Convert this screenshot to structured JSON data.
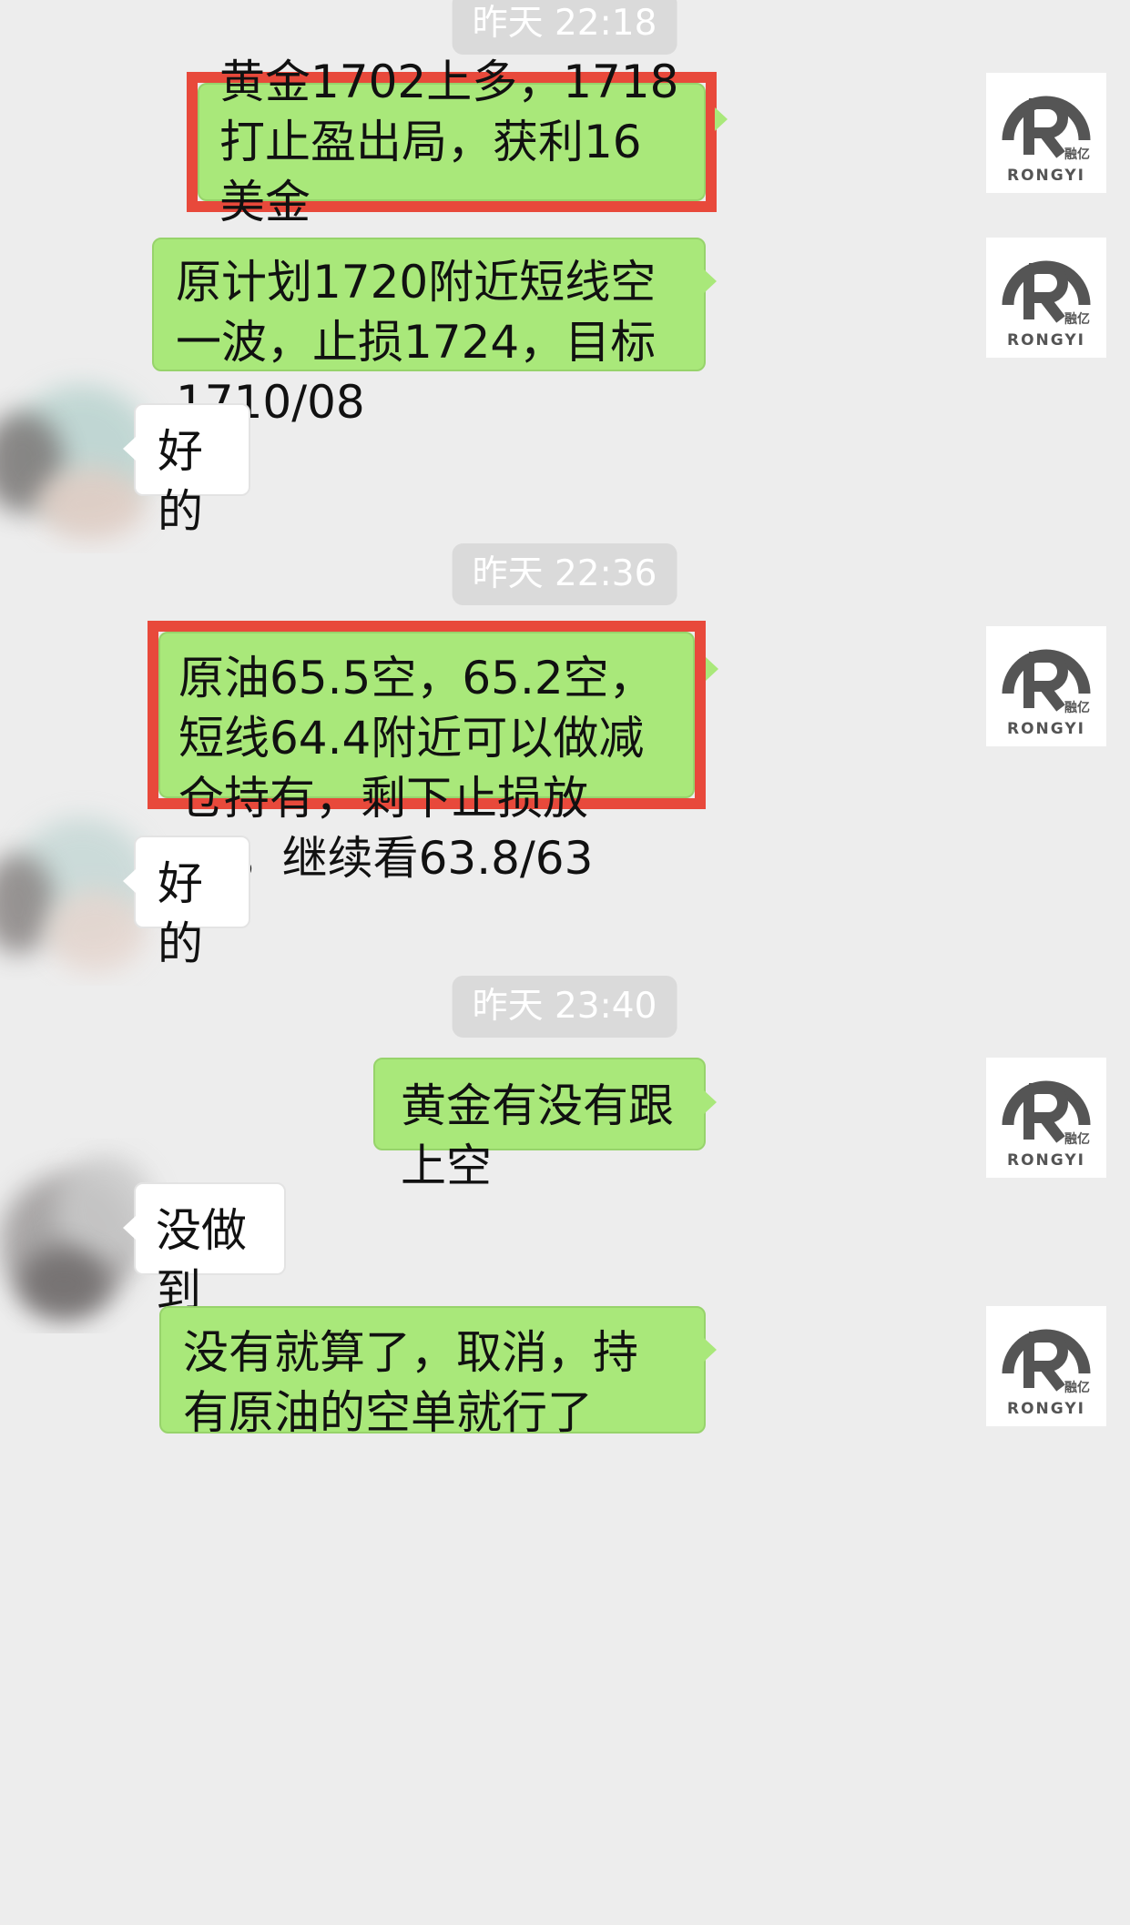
{
  "messages": [
    {
      "type": "timestamp",
      "text": "昨天 22:18"
    },
    {
      "type": "out",
      "text": "黄金1702上多，1718打止盈出局，获利16美金",
      "highlighted": true,
      "avatar": "rongyi-logo"
    },
    {
      "type": "out",
      "text": "原计划1720附近短线空一波，止损1724，目标1710/08",
      "highlighted": false,
      "avatar": "rongyi-logo"
    },
    {
      "type": "in",
      "text": "好的",
      "avatar": "blurred-avatar"
    },
    {
      "type": "timestamp",
      "text": "昨天 22:36"
    },
    {
      "type": "out",
      "text": "原油65.5空，65.2空，短线64.4附近可以做减仓持有，剩下止损放65，继续看63.8/63",
      "highlighted": true,
      "avatar": "rongyi-logo"
    },
    {
      "type": "in",
      "text": "好的",
      "avatar": "blurred-avatar"
    },
    {
      "type": "timestamp",
      "text": "昨天 23:40"
    },
    {
      "type": "out",
      "text": "黄金有没有跟上空",
      "highlighted": false,
      "avatar": "rongyi-logo"
    },
    {
      "type": "in",
      "text": "没做到",
      "avatar": "blurred-avatar"
    },
    {
      "type": "out",
      "text": "没有就算了，取消，持有原油的空单就行了",
      "highlighted": false,
      "avatar": "rongyi-logo"
    }
  ],
  "avatar_logo": {
    "cn_text": "融亿",
    "en_text": "RONGYI",
    "color": "#555555"
  },
  "colors": {
    "background": "#ededed",
    "outgoing_bubble": "#a9e87a",
    "incoming_bubble": "#ffffff",
    "highlight_border": "#e8493b",
    "timestamp_bg": "#dadada"
  }
}
